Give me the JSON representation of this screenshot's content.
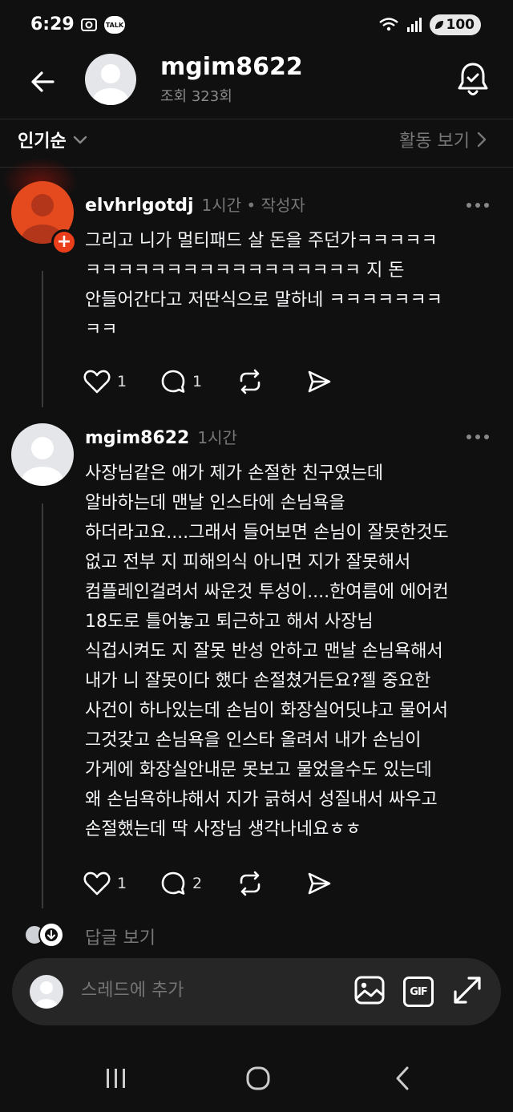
{
  "status_bar": {
    "time": "6:29",
    "talk_label": "TALK",
    "battery": "100"
  },
  "header": {
    "username": "mgim8622",
    "views": "조회 323회"
  },
  "sort": {
    "selected": "인기순",
    "activity_link": "활동 보기"
  },
  "comments": [
    {
      "author": "elvhrlgotdj",
      "meta": "1시간 • 작성자",
      "body": "그리고 니가 멀티패드 살 돈을 주던가ㅋㅋㅋㅋㅋ\nㅋㅋㅋㅋㅋㅋㅋㅋㅋㅋㅋㅋㅋㅋㅋㅋㅋ 지 돈\n안들어간다고 저딴식으로 말하네 ㅋㅋㅋㅋㅋㅋㅋ\nㅋㅋ",
      "likes": "1",
      "replies": "1",
      "avatar_color": "#e54a1e"
    },
    {
      "author": "mgim8622",
      "meta": "1시간",
      "body": "사장님같은 애가 제가 손절한 친구였는데\n알바하는데 맨날 인스타에 손님욕을\n하더라고요....그래서 들어보면 손님이 잘못한것도\n없고 전부 지 피해의식 아니면 지가 잘못해서\n컴플레인걸려서 싸운것 투성이....한여름에 에어컨\n18도로 틀어놓고 퇴근하고 해서 사장님\n식겁시켜도 지 잘못 반성 안하고 맨날 손님욕해서\n내가 니 잘못이다 했다 손절쳤거든요?젤 중요한\n사건이 하나있는데 손님이 화장실어딧냐고 물어서\n그것갖고 손님욕을 인스타 올려서 내가 손님이\n가게에 화장실안내문 못보고 물었을수도 있는데\n왜 손님욕하냐해서 지가 긁혀서 성질내서 싸우고\n손절했는데 딱 사장님 생각나네요ㅎㅎ",
      "likes": "1",
      "replies": "2",
      "avatar_color": "#e4e6e9"
    }
  ],
  "replies_link": "답글 보기",
  "composer": {
    "placeholder": "스레드에 추가",
    "gif_label": "GIF"
  },
  "icons": [
    "back-arrow-icon",
    "bell-icon",
    "chevron-down-icon",
    "chevron-right-icon",
    "heart-icon",
    "comment-icon",
    "repost-icon",
    "share-icon",
    "image-icon",
    "gif-icon",
    "expand-icon",
    "more-icon",
    "recents-icon",
    "home-icon",
    "nav-back-icon"
  ]
}
